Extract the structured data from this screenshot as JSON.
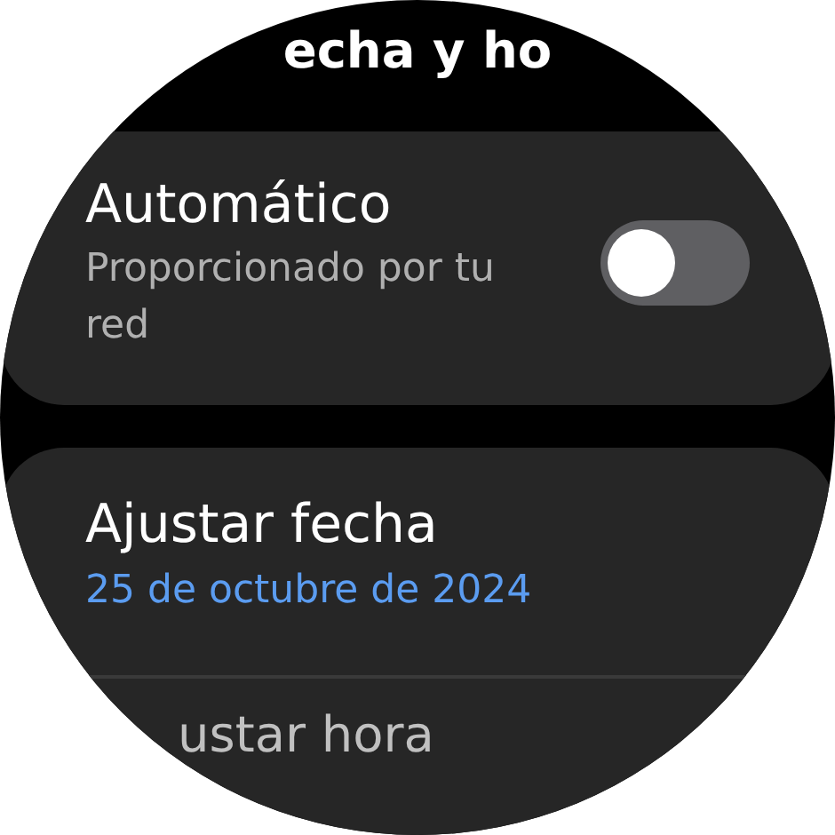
{
  "header": {
    "title": "echa y ho"
  },
  "automatic": {
    "title": "Automático",
    "subtitle": "Proporcionado por tu red",
    "on": false
  },
  "date": {
    "title": "Ajustar fecha",
    "value": "25 de octubre de 2024"
  },
  "time": {
    "title": "ustar hora"
  }
}
